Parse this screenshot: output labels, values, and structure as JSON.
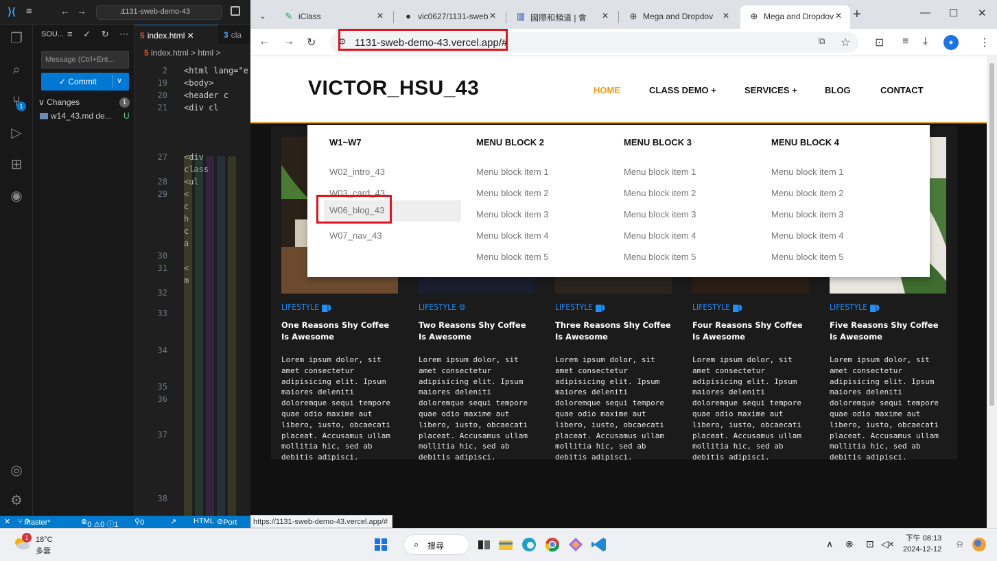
{
  "vscode": {
    "search_text": "1131-sweb-demo-43",
    "sidebar_header": "SOU...",
    "message_placeholder": "Message (Ctrl+Ent...",
    "commit_label": "Commit",
    "changes_label": "Changes",
    "changes_count": "1",
    "changed_file": "w14_43.md de...",
    "changed_file_status": "U",
    "tabs": [
      "index.html",
      "cla"
    ],
    "breadcrumb": "index.html > html >",
    "code_lines": [
      {
        "n": "2",
        "code": "<html lang=\"e"
      },
      {
        "n": "19",
        "code": "<body>"
      },
      {
        "n": "20",
        "code": "<header c"
      },
      {
        "n": "21",
        "code": "<div cl"
      },
      {
        "n": "27",
        "code": "<div"
      },
      {
        "n": "",
        "code": "class"
      },
      {
        "n": "28",
        "code": "<ul"
      },
      {
        "n": "29",
        "code": "<"
      },
      {
        "n": "",
        "code": "c"
      },
      {
        "n": "",
        "code": "h"
      },
      {
        "n": "",
        "code": "c"
      },
      {
        "n": "",
        "code": "a"
      },
      {
        "n": "30",
        "code": ""
      },
      {
        "n": "31",
        "code": "<"
      },
      {
        "n": "",
        "code": "m"
      },
      {
        "n": "32",
        "code": ""
      },
      {
        "n": "33",
        "code": ""
      },
      {
        "n": "34",
        "code": ""
      },
      {
        "n": "35",
        "code": ""
      },
      {
        "n": "36",
        "code": ""
      },
      {
        "n": "37",
        "code": ""
      },
      {
        "n": "38",
        "code": ""
      }
    ],
    "status": {
      "branch": "master*",
      "problems": "0 ⚠0 ⓘ1",
      "ports": "0",
      "language": "HTML",
      "port_label": "Port"
    }
  },
  "browser": {
    "tabs": [
      {
        "title": "iClass",
        "active": false
      },
      {
        "title": "vic0627/1131-sweb",
        "active": false
      },
      {
        "title": "國際和頻道 | 會",
        "active": false
      },
      {
        "title": "Mega and Dropdov",
        "active": false
      },
      {
        "title": "Mega and Dropdov",
        "active": true
      }
    ],
    "url": "1131-sweb-demo-43.vercel.app/#",
    "hover_status_url": "https://1131-sweb-demo-43.vercel.app/#"
  },
  "site": {
    "logo": "VICTOR_HSU_43",
    "nav": [
      {
        "label": "HOME",
        "active": true
      },
      {
        "label": "CLASS DEMO +",
        "active": false
      },
      {
        "label": "SERVICES +",
        "active": false
      },
      {
        "label": "BLOG",
        "active": false
      },
      {
        "label": "CONTACT",
        "active": false
      }
    ],
    "mega_menu": [
      {
        "heading": "W1~W7",
        "items": [
          "W02_intro_43",
          "W03_card_43",
          "W06_blog_43",
          "W07_nav_43"
        ]
      },
      {
        "heading": "MENU BLOCK 2",
        "items": [
          "Menu block item 1",
          "Menu block item 2",
          "Menu block item 3",
          "Menu block item 4",
          "Menu block item 5"
        ]
      },
      {
        "heading": "MENU BLOCK 3",
        "items": [
          "Menu block item 1",
          "Menu block item 2",
          "Menu block item 3",
          "Menu block item 4",
          "Menu block item 5"
        ]
      },
      {
        "heading": "MENU BLOCK 4",
        "items": [
          "Menu block item 1",
          "Menu block item 2",
          "Menu block item 3",
          "Menu block item 4",
          "Menu block item 5"
        ]
      }
    ],
    "hovered_item": "W06_blog_43",
    "cards": [
      {
        "category": "LIFESTYLE",
        "icon": "coffee-icon",
        "title": "One Reasons Shy Coffee Is Awesome",
        "body": "Lorem ipsum dolor, sit amet consectetur adipisicing elit. Ipsum maiores deleniti doloremque sequi tempore quae odio maxime aut libero, iusto, obcaecati placeat. Accusamus ullam mollitia hic, sed ab debitis adipisci."
      },
      {
        "category": "LIFESTYLE",
        "icon": "globe-icon",
        "title": "Two Reasons Shy Coffee Is Awesome",
        "body": "Lorem ipsum dolor, sit amet consectetur adipisicing elit. Ipsum maiores deleniti doloremque sequi tempore quae odio maxime aut libero, iusto, obcaecati placeat. Accusamus ullam mollitia hic, sed ab debitis adipisci."
      },
      {
        "category": "LIFESTYLE",
        "icon": "coffee-icon",
        "title": "Three Reasons Shy Coffee Is Awesome",
        "body": "Lorem ipsum dolor, sit amet consectetur adipisicing elit. Ipsum maiores deleniti doloremque sequi tempore quae odio maxime aut libero, iusto, obcaecati placeat. Accusamus ullam mollitia hic, sed ab debitis adipisci."
      },
      {
        "category": "LIFESTYLE",
        "icon": "coffee-icon",
        "title": "Four Reasons Shy Coffee Is Awesome",
        "body": "Lorem ipsum dolor, sit amet consectetur adipisicing elit. Ipsum maiores deleniti doloremque sequi tempore quae odio maxime aut libero, iusto, obcaecati placeat. Accusamus ullam mollitia hic, sed ab debitis adipisci."
      },
      {
        "category": "LIFESTYLE",
        "icon": "coffee-icon",
        "title": "Five Reasons Shy Coffee Is Awesome",
        "body": "Lorem ipsum dolor, sit amet consectetur adipisicing elit. Ipsum maiores deleniti doloremque sequi tempore quae odio maxime aut libero, iusto, obcaecati placeat. Accusamus ullam mollitia hic, sed ab debitis adipisci."
      }
    ]
  },
  "taskbar": {
    "weather_badge": "1",
    "temperature": "18°C",
    "condition": "多雲",
    "search_label": "搜尋",
    "time": "下午 08:13",
    "date": "2024-12-12"
  },
  "colors": {
    "accent_orange": "#f39c12",
    "link_blue": "#1e90ff",
    "annotation_red": "#e3111b",
    "vscode_blue": "#007acc"
  }
}
